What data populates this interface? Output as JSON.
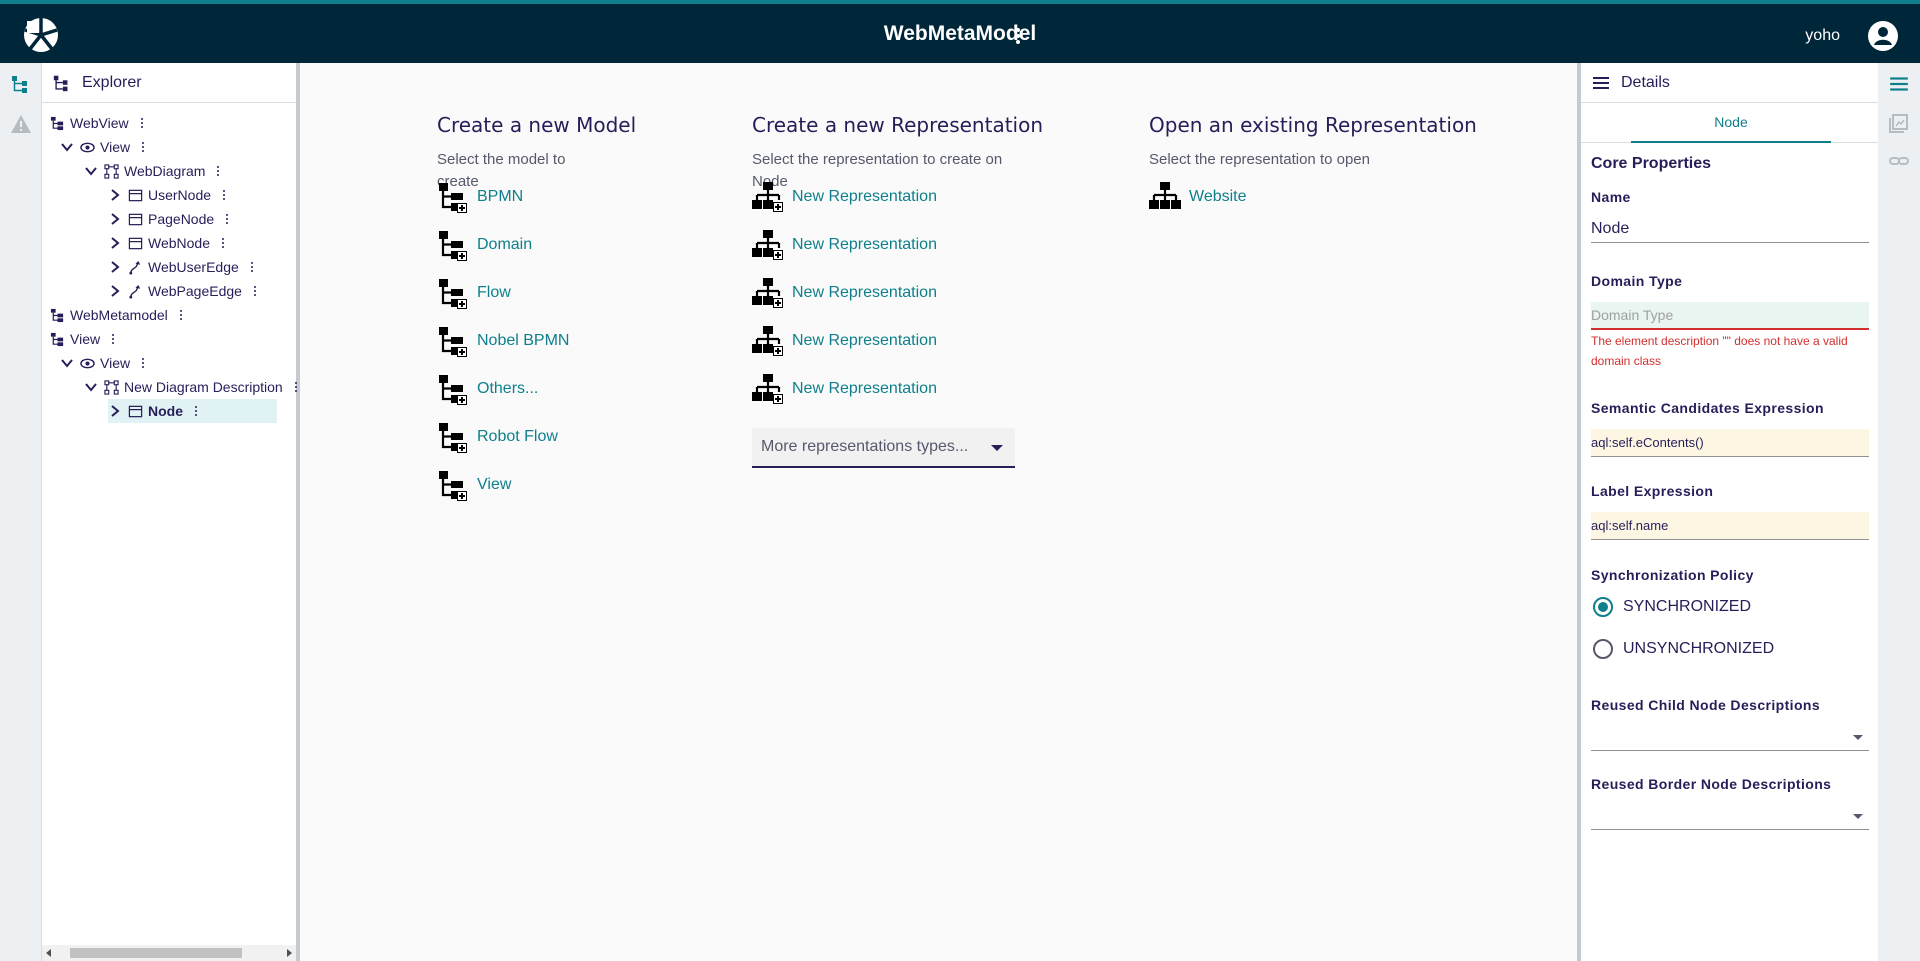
{
  "header": {
    "title": "WebMetaModel",
    "username": "yoho"
  },
  "explorer": {
    "title": "Explorer",
    "tree": [
      {
        "label": "WebView",
        "depth": 0,
        "chevron": "none",
        "icon": "tree-icon",
        "selected": false
      },
      {
        "label": "View",
        "depth": 1,
        "chevron": "down",
        "icon": "eye-icon",
        "selected": false
      },
      {
        "label": "WebDiagram",
        "depth": 2,
        "chevron": "down",
        "icon": "diagram-icon",
        "selected": false
      },
      {
        "label": "UserNode",
        "depth": 3,
        "chevron": "right",
        "icon": "node-icon",
        "selected": false
      },
      {
        "label": "PageNode",
        "depth": 3,
        "chevron": "right",
        "icon": "node-icon",
        "selected": false
      },
      {
        "label": "WebNode",
        "depth": 3,
        "chevron": "right",
        "icon": "node-icon",
        "selected": false
      },
      {
        "label": "WebUserEdge",
        "depth": 3,
        "chevron": "right",
        "icon": "edge-icon",
        "selected": false
      },
      {
        "label": "WebPageEdge",
        "depth": 3,
        "chevron": "right",
        "icon": "edge-icon",
        "selected": false
      },
      {
        "label": "WebMetamodel",
        "depth": 0,
        "chevron": "none",
        "icon": "tree-icon",
        "selected": false
      },
      {
        "label": "View",
        "depth": 0,
        "chevron": "none",
        "icon": "tree-icon",
        "selected": false
      },
      {
        "label": "View",
        "depth": 1,
        "chevron": "down",
        "icon": "eye-icon",
        "selected": false
      },
      {
        "label": "New Diagram Description",
        "depth": 2,
        "chevron": "down",
        "icon": "diagram-icon",
        "selected": false
      },
      {
        "label": "Node",
        "depth": 3,
        "chevron": "right",
        "icon": "node-icon",
        "selected": true
      }
    ]
  },
  "main": {
    "create_model": {
      "title": "Create a new Model",
      "hint": "Select the model to create",
      "items": [
        "BPMN",
        "Domain",
        "Flow",
        "Nobel BPMN",
        "Others...",
        "Robot Flow",
        "View"
      ]
    },
    "create_representation": {
      "title": "Create a new Representation",
      "hint": "Select the representation to create on Node",
      "items": [
        "New Representation",
        "New Representation",
        "New Representation",
        "New Representation",
        "New Representation"
      ],
      "more": "More representations types..."
    },
    "open_representation": {
      "title": "Open an existing Representation",
      "hint": "Select the representation to open",
      "items": [
        "Website"
      ]
    }
  },
  "details": {
    "title": "Details",
    "tab": "Node",
    "section": "Core Properties",
    "name_label": "Name",
    "name_value": "Node",
    "domain_type_label": "Domain Type",
    "domain_type_placeholder": "Domain Type",
    "domain_type_error": "The element description \"\" does not have a valid domain class",
    "semantic_label": "Semantic Candidates Expression",
    "semantic_value": "aql:self.eContents()",
    "label_expr_label": "Label Expression",
    "label_expr_value": "aql:self.name",
    "sync_label": "Synchronization Policy",
    "sync_options": [
      "SYNCHRONIZED",
      "UNSYNCHRONIZED"
    ],
    "sync_selected": "SYNCHRONIZED",
    "reused_child_label": "Reused Child Node Descriptions",
    "reused_border_label": "Reused Border Node Descriptions"
  },
  "colors": {
    "header_bg": "#002639",
    "accent": "#0e7f8b",
    "error": "#d32f2f"
  }
}
